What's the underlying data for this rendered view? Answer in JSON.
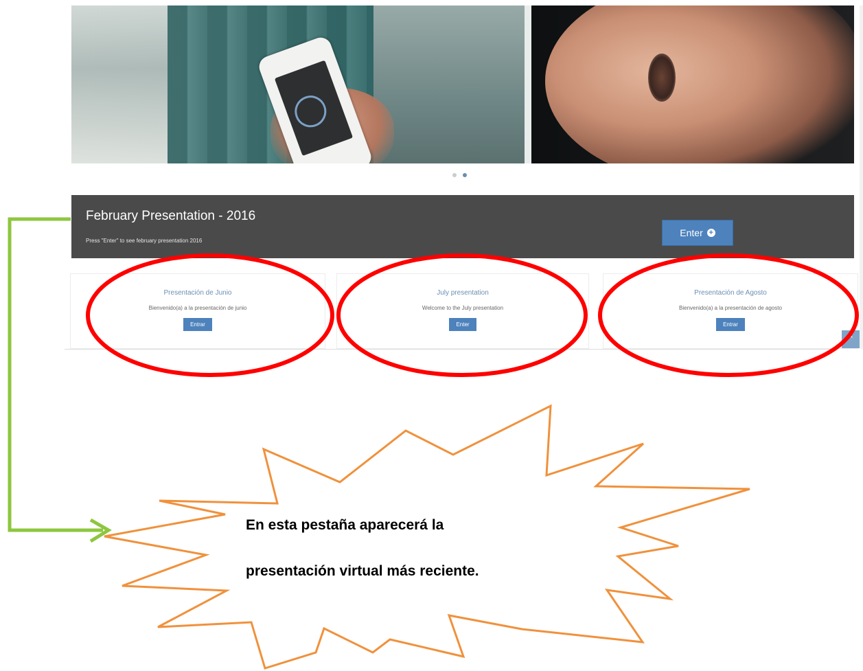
{
  "carousel": {
    "indicators": [
      {
        "active": false
      },
      {
        "active": true
      }
    ]
  },
  "featured": {
    "title": "February Presentation - 2016",
    "subtitle": "Press \"Enter\" to see february presentation 2016",
    "button_label": "Enter",
    "button_icon": "plus-circle-icon"
  },
  "cards": [
    {
      "title": "Presentación de Junio",
      "text": "Bienvenido(a) a la presentación de junio",
      "button_label": "Entrar"
    },
    {
      "title": "July presentation",
      "text": "Welcome to the July presentation",
      "button_label": "Enter"
    },
    {
      "title": "Presentación de Agosto",
      "text": "Bienvenido(a) a la presentación de agosto",
      "button_label": "Entrar"
    }
  ],
  "scroll_top_icon": "chevron-up-icon",
  "annotation": {
    "line1": "En esta pestaña aparecerá la",
    "line2": "presentación virtual más reciente.",
    "highlight_color": "#ff0000",
    "arrow_color": "#8dc63f",
    "burst_color": "#f0913c"
  }
}
